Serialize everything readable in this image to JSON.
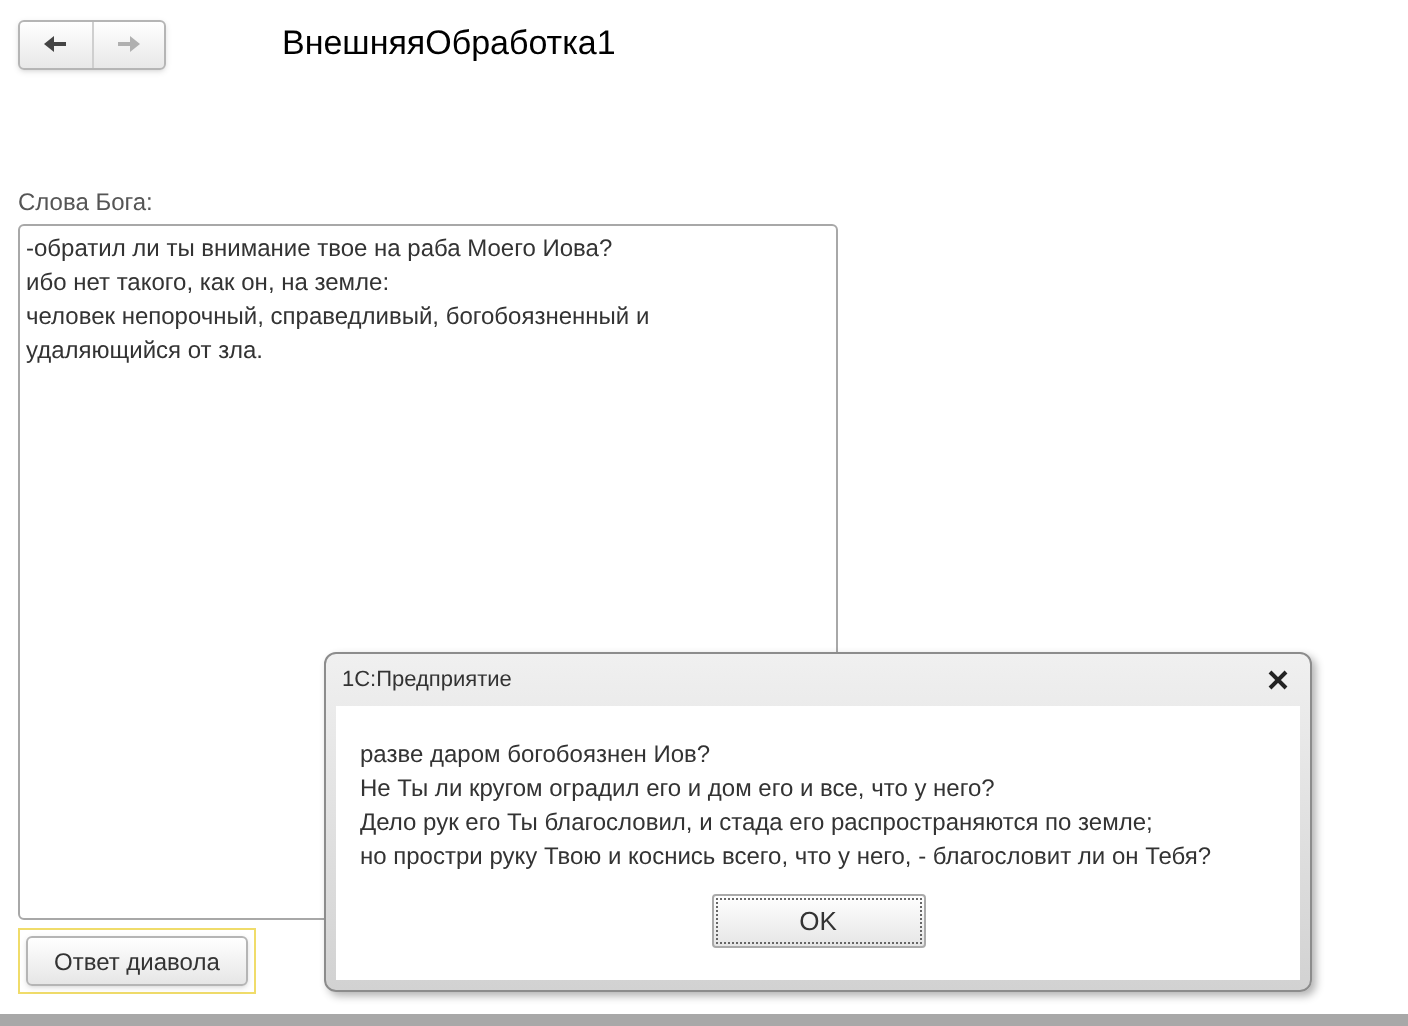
{
  "window": {
    "title": "ВнешняяОбработка1"
  },
  "nav": {
    "back_disabled": false,
    "forward_disabled": true
  },
  "field": {
    "label": "Слова Бога:",
    "value": "-обратил ли ты внимание твое на раба Моего Иова?\nибо нет такого, как он, на земле:\nчеловек непорочный, справедливый, богобоязненный и\nудаляющийся от зла."
  },
  "button": {
    "label": "Ответ диавола",
    "focused": true
  },
  "dialog": {
    "title": "1С:Предприятие",
    "message": "разве даром богобоязнен Иов?\nНе Ты ли кругом оградил его и дом его и все, что у него?\nДело рук его Ты благословил, и стада его распространяются по земле;\nно простри руку Твою и коснись всего, что у него, - благословит ли он Тебя?",
    "button": "OK"
  }
}
